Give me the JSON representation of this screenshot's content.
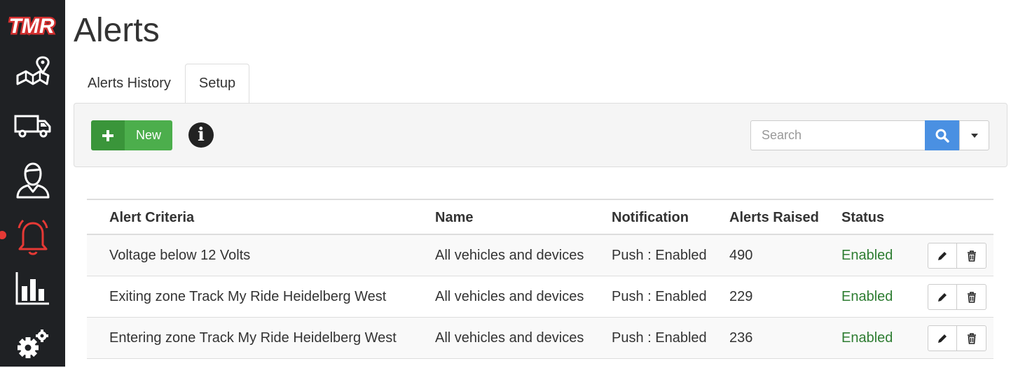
{
  "app": {
    "logo_text": "TMR"
  },
  "sidebar": {
    "items": [
      {
        "icon": "map-pin-icon",
        "active": false
      },
      {
        "icon": "truck-icon",
        "active": false
      },
      {
        "icon": "driver-icon",
        "active": false
      },
      {
        "icon": "bell-icon",
        "active": true
      },
      {
        "icon": "bar-chart-icon",
        "active": false
      },
      {
        "icon": "settings-icon",
        "active": false
      }
    ],
    "active_color": "#e53935"
  },
  "page": {
    "title": "Alerts"
  },
  "tabs": [
    {
      "label": "Alerts History",
      "active": false
    },
    {
      "label": "Setup",
      "active": true
    }
  ],
  "toolbar": {
    "new_label": "New",
    "new_icon": "plus-icon",
    "info_icon": "info-icon",
    "search_placeholder": "Search",
    "search_value": "",
    "search_icon": "search-icon",
    "dropdown_icon": "caret-down-icon"
  },
  "table": {
    "headers": [
      "Alert Criteria",
      "Name",
      "Notification",
      "Alerts Raised",
      "Status"
    ],
    "rows": [
      {
        "criteria": "Voltage below 12 Volts",
        "name": "All vehicles and devices",
        "notification": "Push : Enabled",
        "alerts_raised": "490",
        "status": "Enabled"
      },
      {
        "criteria": "Exiting zone Track My Ride Heidelberg West",
        "name": "All vehicles and devices",
        "notification": "Push : Enabled",
        "alerts_raised": "229",
        "status": "Enabled"
      },
      {
        "criteria": "Entering zone Track My Ride Heidelberg West",
        "name": "All vehicles and devices",
        "notification": "Push : Enabled",
        "alerts_raised": "236",
        "status": "Enabled"
      }
    ],
    "row_actions": [
      "pencil-icon",
      "trash-icon"
    ]
  },
  "colors": {
    "sidebar_bg": "#1f2124",
    "new_button": "#4cae4c",
    "search_button": "#4a90e2",
    "status_enabled": "#2e7d32"
  }
}
